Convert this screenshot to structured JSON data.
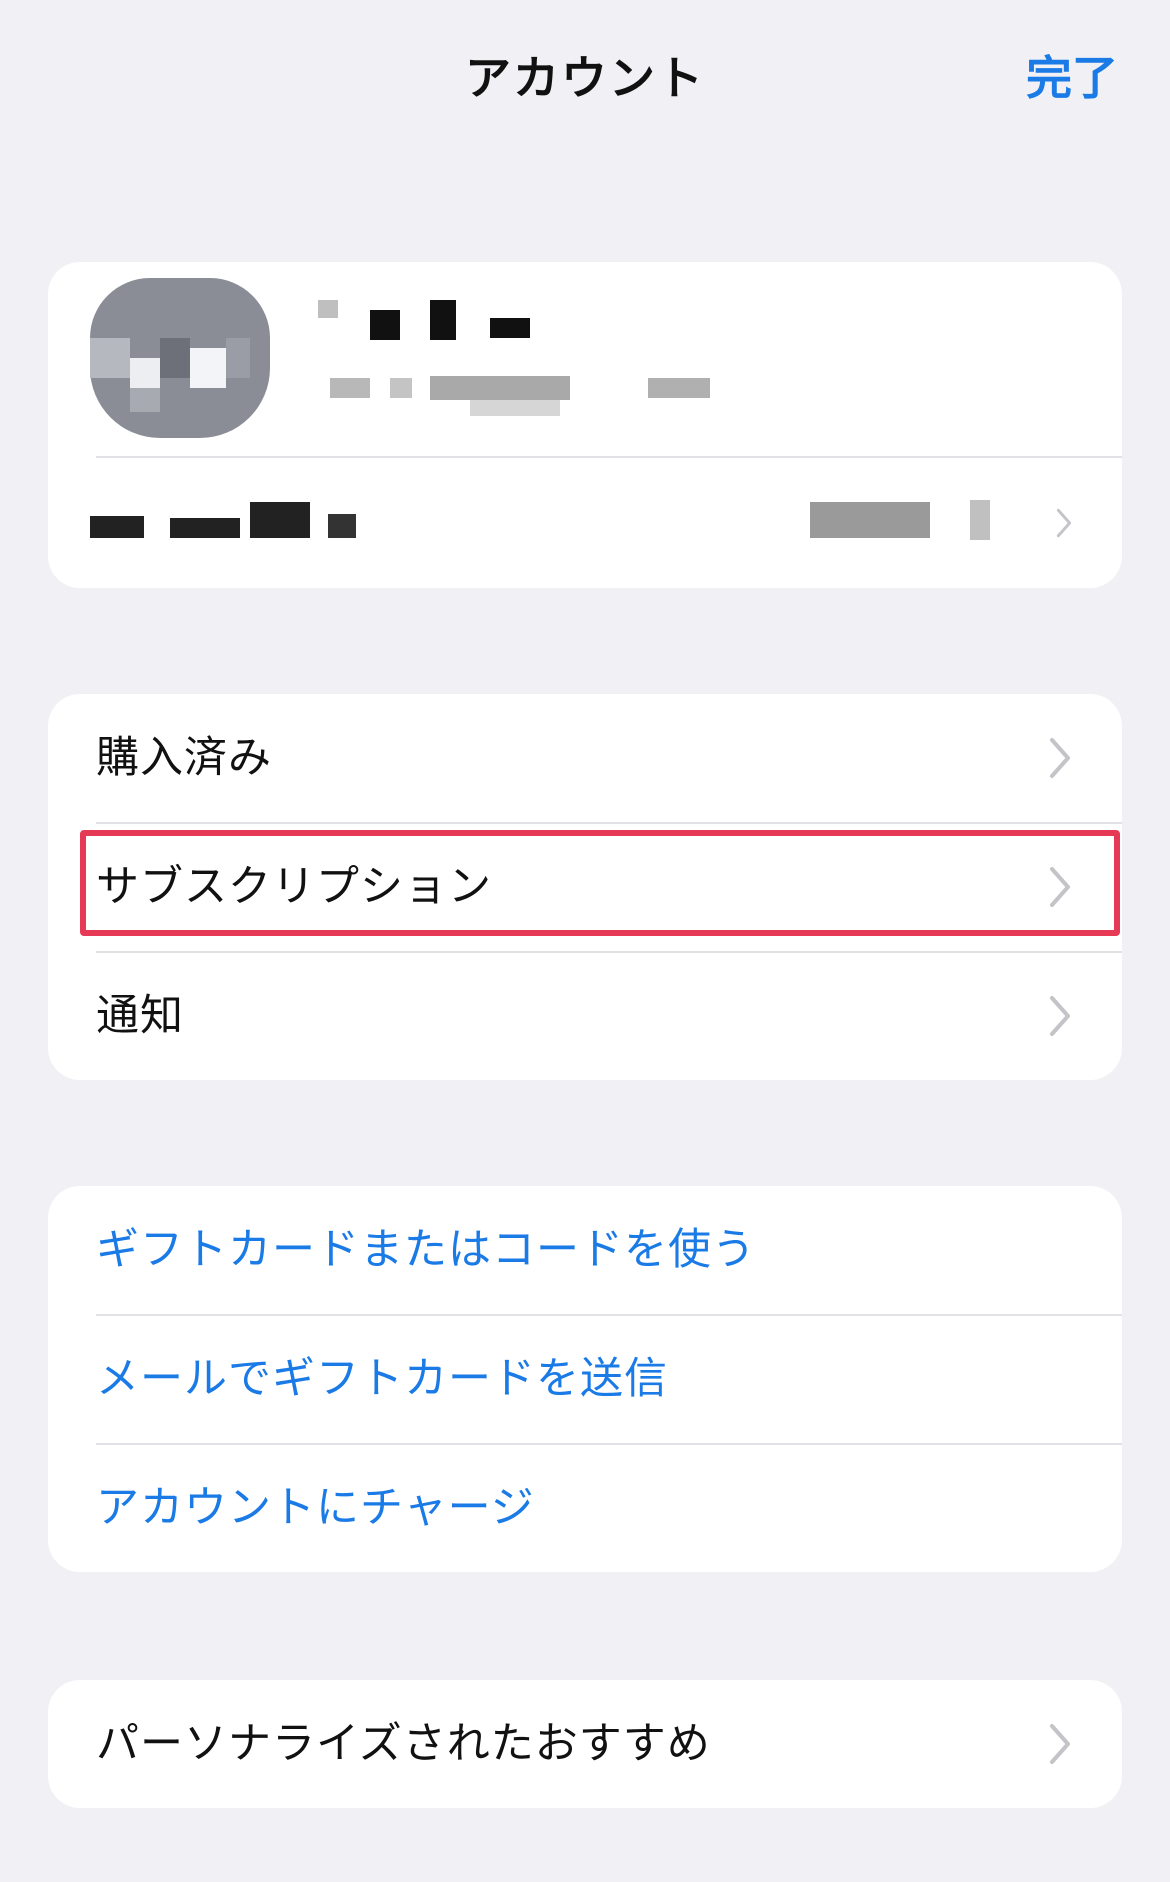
{
  "nav": {
    "title": "アカウント",
    "done_label": "完了"
  },
  "menu": {
    "purchased": "購入済み",
    "subscriptions": "サブスクリプション",
    "notifications": "通知"
  },
  "gift": {
    "redeem": "ギフトカードまたはコードを使う",
    "send_email": "メールでギフトカードを送信",
    "add_funds": "アカウントにチャージ"
  },
  "personalized": {
    "label": "パーソナライズされたおすすめ"
  },
  "colors": {
    "accent": "#1a7ae6",
    "highlight": "#e63955",
    "background": "#f1f1f5"
  }
}
